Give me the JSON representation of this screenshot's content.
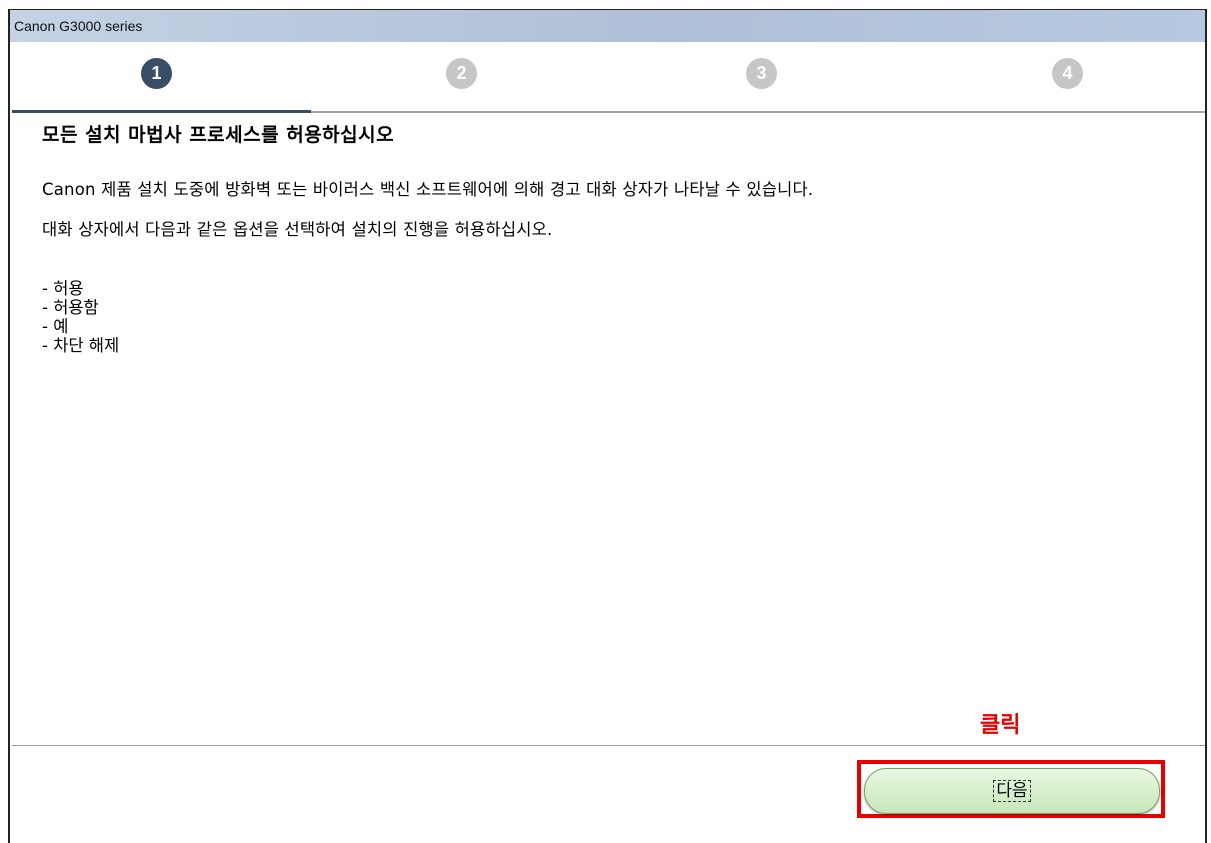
{
  "window": {
    "title": "Canon G3000 series"
  },
  "steps": [
    {
      "number": "1",
      "state": "active"
    },
    {
      "number": "2",
      "state": "inactive"
    },
    {
      "number": "3",
      "state": "inactive"
    },
    {
      "number": "4",
      "state": "inactive"
    }
  ],
  "main": {
    "heading": "모든 설치 마법사 프로세스를 허용하십시오",
    "description_line1": "Canon 제품 설치 도중에 방화벽 또는 바이러스 백신 소프트웨어에 의해 경고 대화 상자가 나타날 수 있습니다.",
    "description_line2": "대화 상자에서 다음과 같은 옵션을 선택하여 설치의 진행을 허용하십시오.",
    "options": [
      "- 허용",
      "- 허용함",
      "- 예",
      "- 차단 해제"
    ]
  },
  "footer": {
    "next_label": "다음"
  },
  "annotation": {
    "label": "클릭",
    "color": "#e60000"
  },
  "colors": {
    "active_step": "#3a4d66",
    "inactive_step": "#c6c6c6",
    "button_green": "#d6efca"
  }
}
